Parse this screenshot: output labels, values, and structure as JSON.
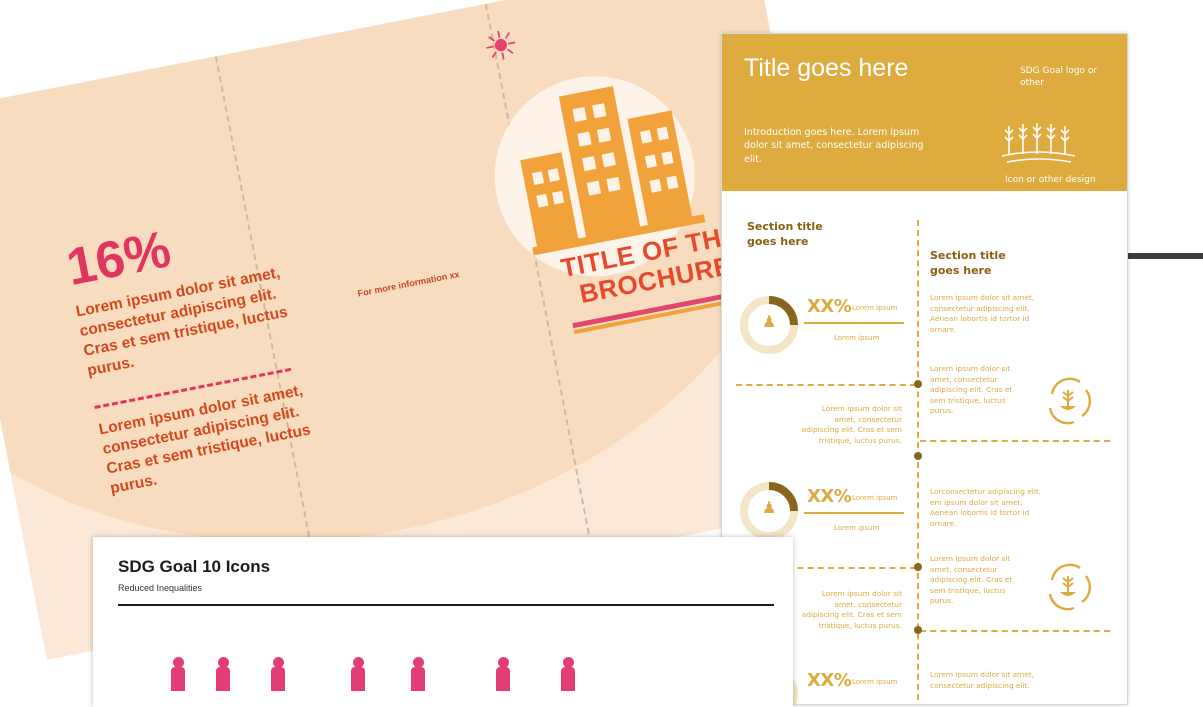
{
  "brochure": {
    "stat": "16%",
    "paragraph_1": "Lorem ipsum dolor sit amet, consectetur adipiscing elit. Cras et sem tristique, luctus purus.",
    "paragraph_2": "Lorem ipsum dolor sit amet, consectetur adipiscing elit. Cras et sem tristique, luctus purus.",
    "more_info": "For more information xx",
    "title": "TITLE OF THE BROCHURE",
    "colors": {
      "background": "#fbe8d6",
      "stat": "#e0365e",
      "text": "#d2491f",
      "buildings": "#f2a23a"
    },
    "icons": [
      "sun-icon",
      "buildings-icon"
    ]
  },
  "infographic": {
    "title": "Title goes here",
    "intro": "Introduction goes here. Lorem ipsum dolor sit amet, consectetur adipiscing elit.",
    "logo_text": "SDG Goal logo or other",
    "design_text": "Icon or other design",
    "section_left": "Section title goes here",
    "section_right": "Section title goes here",
    "right_text_1": "Lorem ipsum dolor sit amet, consectetur adipiscing elit. Aenean lobortis id tortor id ornare.",
    "right_text_2": "Lorem ipsum dolor sit amet, consectetur adipiscing elit. Cras et sem tristique, luctus purus.",
    "right_text_3": "Lorconsectetur adipiscing elit. em ipsum dolor sit amet, Aenean lobortis id tortor id ornare.",
    "right_text_4": "Lorem ipsum dolor sit amet, consectetur adipiscing elit. Cras et sem tristique, luctus purus.",
    "right_text_5": "Lorem ipsum dolor sit amet, consectetur adipiscing elit.",
    "left_text_1": "Lorem ipsum dolor sit amet, consectetur adipiscing elit. Cras et sem tristique, luctus purus.",
    "left_text_2": "Lorem ipsum dolor sit amet, consectetur adipiscing elit. Cras et sem tristique, luctus purus.",
    "stats": [
      {
        "value": "XX%",
        "label": "Lorem ipsum",
        "caption": "Lorem ipsum",
        "fill": 0.25
      },
      {
        "value": "XX%",
        "label": "Lorem ipsum",
        "caption": "Lorem ipsum",
        "fill": 0.25
      },
      {
        "value": "XX%",
        "label": "Lorem ipsum",
        "fill": 0.25
      }
    ],
    "colors": {
      "header": "#ddab3e",
      "accent": "#8a6520",
      "ring": "#f4e5c6"
    },
    "icons": [
      "wheat-icon",
      "person-icon",
      "cycle-plant-icon"
    ]
  },
  "sdg_card": {
    "title": "SDG Goal 10 Icons",
    "subtitle": "Reduced Inequalities",
    "color": "#e23e75"
  }
}
